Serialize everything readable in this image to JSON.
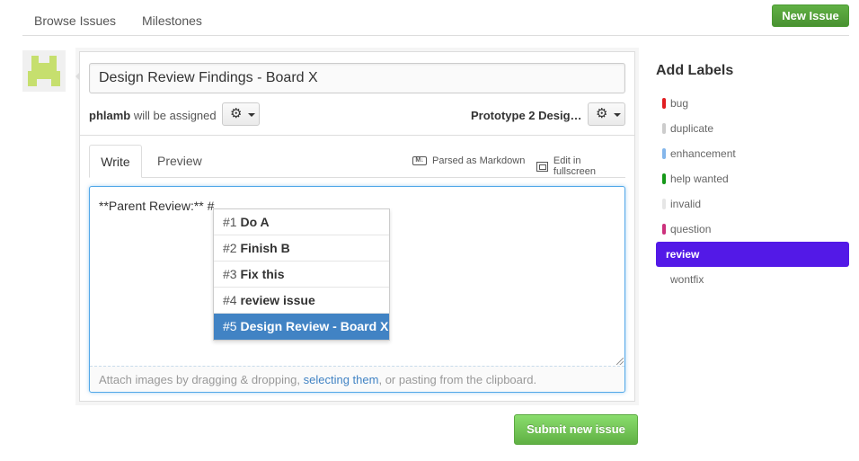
{
  "nav": {
    "browse": "Browse Issues",
    "milestones": "Milestones",
    "new_issue": "New Issue"
  },
  "form": {
    "title_value": "Design Review Findings - Board X",
    "assignee_user": "phlamb",
    "assignee_suffix": " will be assigned",
    "milestone": "Prototype 2 Desig…",
    "tab_write": "Write",
    "tab_preview": "Preview",
    "markdown_note": "Parsed as Markdown",
    "fullscreen_note": "Edit in fullscreen",
    "body_text": "**Parent Review:** #",
    "attach_prefix": "Attach images by dragging & dropping, ",
    "attach_link": "selecting them",
    "attach_suffix": ", or pasting from the clipboard.",
    "submit": "Submit new issue"
  },
  "suggestions": [
    {
      "num": "#1",
      "title": "Do A",
      "active": false
    },
    {
      "num": "#2",
      "title": "Finish B",
      "active": false
    },
    {
      "num": "#3",
      "title": "Fix this",
      "active": false
    },
    {
      "num": "#4",
      "title": "review issue",
      "active": false
    },
    {
      "num": "#5",
      "title": "Design Review - Board X",
      "active": true
    }
  ],
  "labels": {
    "title": "Add Labels",
    "items": [
      {
        "name": "bug",
        "color": "#e11d21",
        "selected": false
      },
      {
        "name": "duplicate",
        "color": "#cccccc",
        "selected": false
      },
      {
        "name": "enhancement",
        "color": "#84b6eb",
        "selected": false
      },
      {
        "name": "help wanted",
        "color": "#159818",
        "selected": false
      },
      {
        "name": "invalid",
        "color": "#e6e6e6",
        "selected": false
      },
      {
        "name": "question",
        "color": "#cc317c",
        "selected": false
      },
      {
        "name": "review",
        "color": "#5319e7",
        "selected": true
      },
      {
        "name": "wontfix",
        "color": "#ffffff",
        "selected": false
      }
    ]
  },
  "icons": {
    "avatar": "identicon-avatar",
    "gear": "gear-icon",
    "markdown": "markdown-icon",
    "fullscreen": "fullscreen-icon"
  },
  "colors": {
    "primary_green": "#60b044",
    "link_blue": "#4183c4",
    "selected_label": "#5319e7"
  }
}
